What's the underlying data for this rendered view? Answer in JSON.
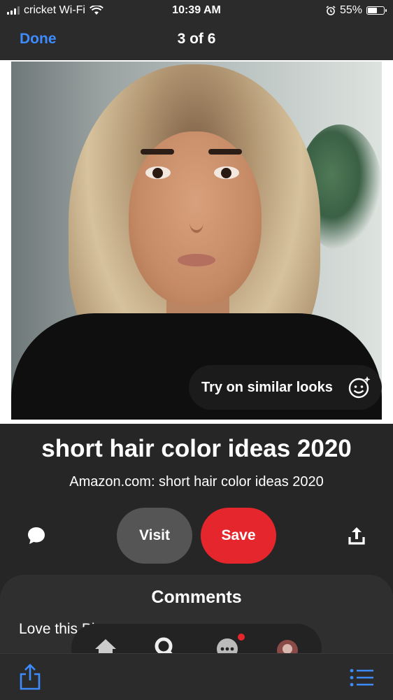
{
  "status_bar": {
    "carrier": "cricket Wi-Fi",
    "time": "10:39 AM",
    "battery_percent_label": "55%",
    "battery_level": 0.55,
    "icons": [
      "signal-icon",
      "wifi-icon",
      "alarm-icon",
      "battery-icon"
    ]
  },
  "nav": {
    "done_label": "Done",
    "title": "3 of 6"
  },
  "pin": {
    "try_on_label": "Try on similar looks",
    "title": "short hair color ideas 2020",
    "source": "Amazon.com: short hair color ideas 2020"
  },
  "actions": {
    "visit_label": "Visit",
    "save_label": "Save",
    "icons": [
      "comment-icon",
      "share-icon"
    ]
  },
  "comments": {
    "heading": "Comments",
    "first_comment_partial": "Love this Pi"
  },
  "floating_nav": {
    "icons": [
      "home-icon",
      "search-icon",
      "messages-icon",
      "profile-avatar"
    ],
    "has_notification": true
  },
  "toolbar": {
    "icons": [
      "share-icon",
      "list-icon"
    ]
  },
  "colors": {
    "accent_blue": "#3d8bfd",
    "save_red": "#e5262c",
    "background": "#262626"
  }
}
